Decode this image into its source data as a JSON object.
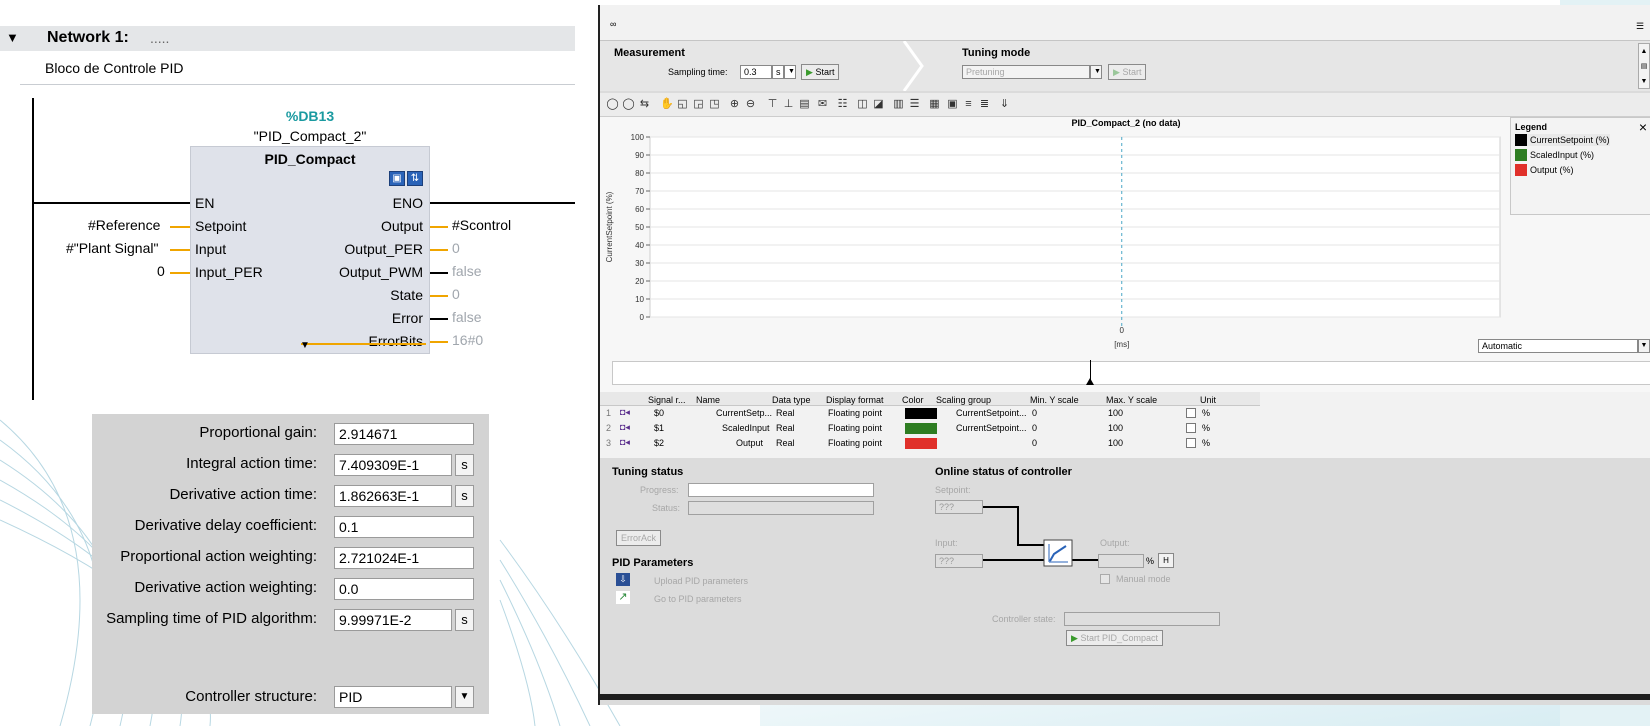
{
  "network": {
    "title": "Network 1:",
    "title_dots": ".....",
    "comment": "Bloco de Controle PID"
  },
  "fb": {
    "db_addr": "%DB13",
    "instance": "\"PID_Compact_2\"",
    "type": "PID_Compact",
    "en": "EN",
    "eno": "ENO",
    "inputs": [
      {
        "pin": "Setpoint",
        "value": "#Reference"
      },
      {
        "pin": "Input",
        "value": "#\"Plant Signal\""
      },
      {
        "pin": "Input_PER",
        "value": "0"
      }
    ],
    "outputs": [
      {
        "pin": "Output",
        "value": "#Scontrol"
      },
      {
        "pin": "Output_PER",
        "value": "0"
      },
      {
        "pin": "Output_PWM",
        "value": "false"
      },
      {
        "pin": "State",
        "value": "0"
      },
      {
        "pin": "Error",
        "value": "false"
      },
      {
        "pin": "ErrorBits",
        "value": "16#0"
      }
    ],
    "expand_glyph": "▼"
  },
  "params": [
    {
      "label": "Proportional gain:",
      "value": "2.914671",
      "unit": ""
    },
    {
      "label": "Integral action time:",
      "value": "7.409309E-1",
      "unit": "s"
    },
    {
      "label": "Derivative action time:",
      "value": "1.862663E-1",
      "unit": "s"
    },
    {
      "label": "Derivative delay coefficient:",
      "value": "0.1",
      "unit": ""
    },
    {
      "label": "Proportional action weighting:",
      "value": "2.721024E-1",
      "unit": ""
    },
    {
      "label": "Derivative action weighting:",
      "value": "0.0",
      "unit": ""
    },
    {
      "label": "Sampling time of PID algorithm:",
      "value": "9.99971E-2",
      "unit": "s"
    }
  ],
  "controller_structure": {
    "label": "Controller structure:",
    "value": "PID"
  },
  "measurement": {
    "title": "Measurement",
    "sampling_label": "Sampling time:",
    "sampling_value": "0.3",
    "sampling_unit": "s",
    "start": "Start"
  },
  "tuning_mode": {
    "title": "Tuning mode",
    "mode": "Pretuning",
    "start": "Start"
  },
  "chart": {
    "title": "PID_Compact_2 (no data)",
    "ylabel": "CurrentSetpoint (%)",
    "xlabel": "[ms]",
    "x_tick": "0",
    "scale_mode": "Automatic"
  },
  "chart_data": {
    "type": "line",
    "title": "PID_Compact_2 (no data)",
    "xlabel": "[ms]",
    "ylabel": "CurrentSetpoint (%)",
    "ylim": [
      0,
      100
    ],
    "yticks": [
      0,
      10,
      20,
      30,
      40,
      50,
      60,
      70,
      80,
      90,
      100
    ],
    "xticks": [
      0
    ],
    "grid": true,
    "legend_position": "top-right",
    "series": [
      {
        "name": "CurrentSetpoint (%)",
        "color": "#000000",
        "values": []
      },
      {
        "name": "ScaledInput (%)",
        "color": "#2e7d22",
        "values": []
      },
      {
        "name": "Output (%)",
        "color": "#e0302a",
        "values": []
      }
    ]
  },
  "legend": {
    "title": "Legend",
    "close": "×",
    "items": [
      {
        "name": "CurrentSetpoint (%)",
        "color": "#000000"
      },
      {
        "name": "ScaledInput (%)",
        "color": "#2e7d22"
      },
      {
        "name": "Output (%)",
        "color": "#e0302a"
      }
    ]
  },
  "signal_table": {
    "headers": [
      "Signal r...",
      "Name",
      "Data type",
      "Display format",
      "Color",
      "Scaling group",
      "Min. Y scale",
      "Max. Y scale",
      "Unit"
    ],
    "rows": [
      {
        "idx": "1",
        "ref": "$0",
        "name": "CurrentSetp...",
        "type": "Real",
        "format": "Floating point",
        "color": "#000000",
        "group": "CurrentSetpoint...",
        "min": "0",
        "max": "100",
        "unit": "%"
      },
      {
        "idx": "2",
        "ref": "$1",
        "name": "ScaledInput",
        "type": "Real",
        "format": "Floating point",
        "color": "#2e7d22",
        "group": "CurrentSetpoint...",
        "min": "0",
        "max": "100",
        "unit": "%"
      },
      {
        "idx": "3",
        "ref": "$2",
        "name": "Output",
        "type": "Real",
        "format": "Floating point",
        "color": "#e0302a",
        "group": "",
        "min": "0",
        "max": "100",
        "unit": "%"
      }
    ]
  },
  "tuning_status": {
    "title": "Tuning status",
    "progress": "Progress:",
    "status": "Status:",
    "errorack": "ErrorAck"
  },
  "pid_parameters": {
    "title": "PID Parameters",
    "upload": "Upload PID parameters",
    "goto": "Go to PID parameters"
  },
  "online_status": {
    "title": "Online status of controller",
    "setpoint": "Setpoint:",
    "setpoint_val": "???",
    "input": "Input:",
    "input_val": "???",
    "output": "Output:",
    "output_unit": "%",
    "manual": "Manual mode",
    "controller_state": "Controller state:",
    "start": "Start PID_Compact"
  }
}
